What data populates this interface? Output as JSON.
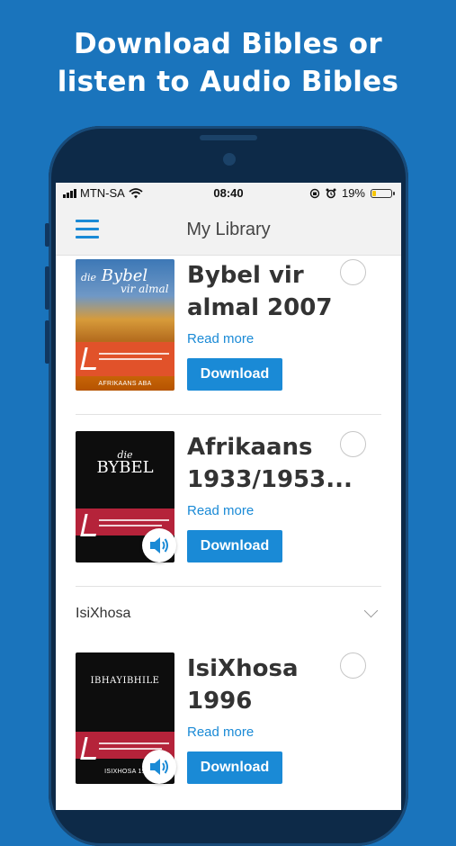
{
  "promo": {
    "line1": "Download Bibles or",
    "line2": "listen to Audio Bibles"
  },
  "status_bar": {
    "carrier": "MTN-SA",
    "time": "08:40",
    "battery_percent": "19%",
    "battery_level": 0.19
  },
  "nav": {
    "title": "My Library",
    "menu_icon": "hamburger-menu-icon"
  },
  "items": [
    {
      "title": "Bybel vir almal 2007",
      "read_more": "Read more",
      "download": "Download",
      "cover": {
        "script": "die Bybel",
        "script_sub": "vir almal",
        "footer": "AFRIKAANS ABA"
      },
      "has_audio": false
    },
    {
      "title": "Afrikaans 1933/1953...",
      "read_more": "Read more",
      "download": "Download",
      "cover": {
        "script": "die",
        "word": "BYBEL"
      },
      "has_audio": true
    }
  ],
  "section": {
    "label": "IsiXhosa"
  },
  "section_items": [
    {
      "title": "IsiXhosa 1996",
      "read_more": "Read more",
      "download": "Download",
      "cover": {
        "word": "IBHAYIBHILE",
        "footer": "ISIXHOSA 19"
      },
      "has_audio": true
    }
  ],
  "colors": {
    "background": "#1a74bc",
    "accent": "#1a8ad6",
    "bar": "#f2f2f2"
  }
}
